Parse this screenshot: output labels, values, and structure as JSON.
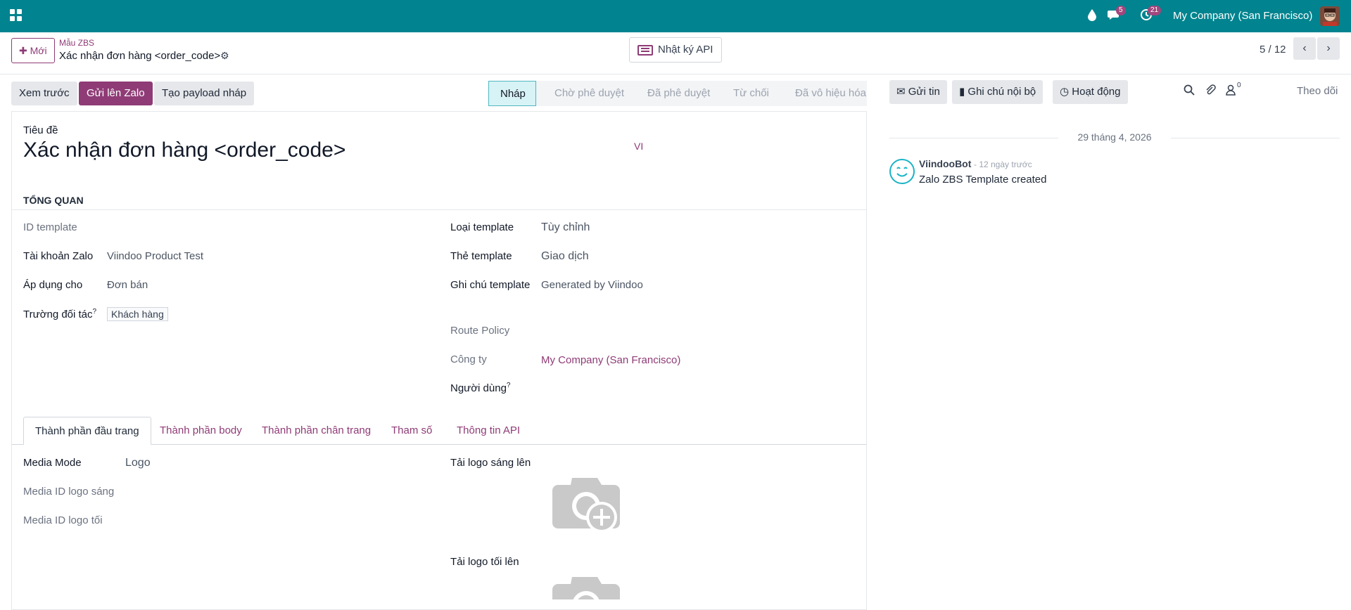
{
  "topbar": {
    "chat_count": "5",
    "activity_count": "21",
    "company": "My Company (San Francisco)"
  },
  "control_panel": {
    "new_label": "Mới",
    "breadcrumb_parent": "Mẫu ZBS",
    "breadcrumb_current": "Xác nhận đơn hàng <order_code>",
    "api_log_label": "Nhật ký API",
    "pager": "5 / 12"
  },
  "actions": {
    "preview": "Xem trước",
    "send_zalo": "Gửi lên Zalo",
    "create_payload": "Tạo payload nháp"
  },
  "stages": [
    {
      "label": "Nháp",
      "active": true
    },
    {
      "label": "Chờ phê duyệt",
      "active": false
    },
    {
      "label": "Đã phê duyệt",
      "active": false
    },
    {
      "label": "Từ chối",
      "active": false
    },
    {
      "label": "Đã vô hiệu hóa",
      "active": false
    }
  ],
  "form": {
    "title_label": "Tiêu đề",
    "title_value": "Xác nhận đơn hàng <order_code>",
    "lang": "VI",
    "section": "TỔNG QUAN",
    "left": {
      "template_id_label": "ID template",
      "zalo_account_label": "Tài khoản Zalo",
      "zalo_account_value": "Viindoo Product Test",
      "apply_for_label": "Áp dụng cho",
      "apply_for_value": "Đơn bán",
      "partner_field_label": "Trường đối tác",
      "partner_field_value": "Khách hàng"
    },
    "right": {
      "template_type_label": "Loại template",
      "template_type_value": "Tùy chỉnh",
      "template_tag_label": "Thẻ template",
      "template_tag_value": "Giao dịch",
      "template_note_label": "Ghi chú template",
      "template_note_value": "Generated by Viindoo",
      "route_policy_label": "Route Policy",
      "company_label": "Công ty",
      "company_value": "My Company (San Francisco)",
      "user_label": "Người dùng"
    },
    "tabs": [
      "Thành phần đầu trang",
      "Thành phần body",
      "Thành phần chân trang",
      "Tham số",
      "Thông tin API"
    ],
    "tab_content": {
      "media_mode_label": "Media Mode",
      "media_mode_value": "Logo",
      "media_light_label": "Media ID logo sáng",
      "media_dark_label": "Media ID logo tối",
      "upload_light_label": "Tải logo sáng lên",
      "upload_dark_label": "Tải logo tối lên"
    }
  },
  "chatter": {
    "send_msg": "Gửi tin",
    "log_note": "Ghi chú nội bộ",
    "activity": "Hoạt động",
    "follower_count": "0",
    "follow": "Theo dõi",
    "date": "29 tháng 4, 2026",
    "author": "ViindooBot",
    "time": "- 12 ngày trước",
    "body": "Zalo ZBS Template created"
  }
}
